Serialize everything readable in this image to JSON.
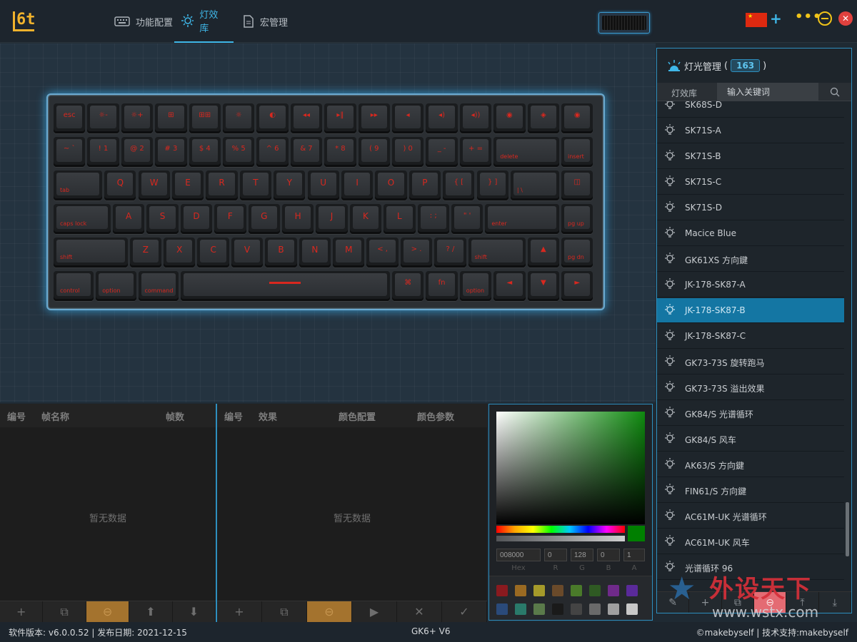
{
  "header": {
    "tabs": [
      {
        "label": "功能配置",
        "icon": "keyboard-icon",
        "active": false
      },
      {
        "label": "灯效库",
        "icon": "light-effect-icon",
        "active": true
      },
      {
        "label": "宏管理",
        "icon": "document-icon",
        "active": false
      }
    ],
    "colors": {
      "accent": "#3fb7e8",
      "logo": "#f0b22c",
      "close": "#e0413e"
    }
  },
  "keyboard": {
    "rows": [
      [
        "esc",
        "☼-",
        "☼+",
        "⊞",
        "⊞⊞",
        "☼",
        "◐",
        "◂◂",
        "▸‖",
        "▸▸",
        "◂",
        "◂)",
        "◂))",
        "◉",
        "◈",
        "◉"
      ],
      [
        "~ `",
        "! 1",
        "@ 2",
        "# 3",
        "$ 4",
        "% 5",
        "^ 6",
        "& 7",
        "* 8",
        "( 9",
        ") 0",
        "_ -",
        "+ =",
        "delete",
        "insert"
      ],
      [
        "tab",
        "Q",
        "W",
        "E",
        "R",
        "T",
        "Y",
        "U",
        "I",
        "O",
        "P",
        "{ [",
        "} ]",
        "| \\",
        "◫"
      ],
      [
        "caps lock",
        "A",
        "S",
        "D",
        "F",
        "G",
        "H",
        "J",
        "K",
        "L",
        ": ;",
        "\" '",
        "enter",
        "pg up"
      ],
      [
        "shift",
        "Z",
        "X",
        "C",
        "V",
        "B",
        "N",
        "M",
        "< ,",
        "> .",
        "? /",
        "shift",
        "▲",
        "pg dn"
      ],
      [
        "control",
        "option",
        "command",
        "",
        "⌘",
        "fn",
        "option",
        "◄",
        "▼",
        "►"
      ]
    ],
    "led_color": "#d8281f"
  },
  "frame_panel": {
    "headers": [
      "编号",
      "帧名称",
      "帧数"
    ],
    "empty_text": "暂无数据",
    "tools": [
      "+",
      "⧉",
      "⊖",
      "⬆",
      "⬇"
    ]
  },
  "effect_panel": {
    "headers": [
      "编号",
      "效果",
      "颜色配置",
      "颜色参数"
    ],
    "empty_text": "暂无数据",
    "tools": [
      "+",
      "⧉",
      "⊖",
      "▶",
      "✕",
      "✓"
    ]
  },
  "color_picker": {
    "hex": "008000",
    "r": "0",
    "g": "128",
    "b": "0",
    "a": "1",
    "labels": [
      "Hex",
      "R",
      "G",
      "B",
      "A"
    ],
    "swatches": [
      "#8a1a1f",
      "#9a6a22",
      "#a59a2a",
      "#6a4a2a",
      "#4a7a2a",
      "#2f5a23",
      "#6f2a8a",
      "#5a2a9a",
      "#2a4a7a",
      "#2a7a6a",
      "#5a7a4a",
      "#1a1a1a",
      "#444444",
      "#6a6a6a",
      "#a0a0a0",
      "#c8c8c8"
    ]
  },
  "light_panel": {
    "title": "灯光管理",
    "count": "163",
    "search_tab": "灯效库",
    "search_placeholder": "输入关键词",
    "items": [
      "SK68S-D",
      "SK71S-A",
      "SK71S-B",
      "SK71S-C",
      "SK71S-D",
      "Macice Blue",
      "GK61XS 方向鍵",
      "JK-178-SK87-A",
      "JK-178-SK87-B",
      "JK-178-SK87-C",
      "GK73-73S 旋转跑马",
      "GK73-73S 溢出效果",
      "GK84/S 光谱循环",
      "GK84/S 风车",
      "AK63/S 方向鍵",
      "FIN61/S 方向鍵",
      "AC61M-UK 光谱循环",
      "AC61M-UK 风车",
      "光谱循环 96"
    ],
    "selected_index": 8,
    "tools": [
      "✎",
      "+",
      "⧉",
      "⊖",
      "⤒",
      "⤓"
    ]
  },
  "status": {
    "version": "软件版本: v6.0.0.52 | 发布日期: 2021-12-15",
    "device": "GK6+ V6",
    "copyright": "©makebyself | 技术支持:makebyself"
  },
  "watermark": {
    "big": "外设天下",
    "url": "www.wstx.com"
  }
}
